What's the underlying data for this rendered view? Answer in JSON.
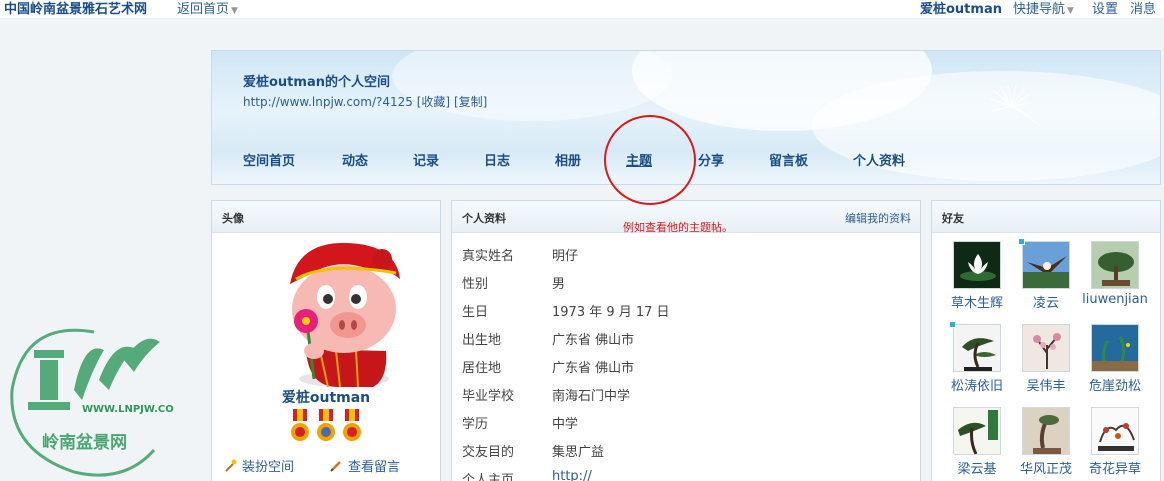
{
  "topbar": {
    "site_name": "中国岭南盆景雅石艺术网",
    "back_home": "返回首页",
    "user": "爱桩outman",
    "quick_nav": "快捷导航",
    "settings": "设置",
    "messages": "消息"
  },
  "banner": {
    "title": "爱桩outman的个人空间",
    "url": "http://www.lnpjw.com/?4125",
    "favorite": "[收藏]",
    "copy": "[复制]"
  },
  "nav": {
    "items": [
      "空间首页",
      "动态",
      "记录",
      "日志",
      "相册",
      "主题",
      "分享",
      "留言板",
      "个人资料"
    ],
    "active": "主题"
  },
  "annotation": "例如查看他的主题帖。",
  "avatar_panel": {
    "title": "头像",
    "username": "爱桩outman",
    "dress_up": "装扮空间",
    "view_messages": "查看留言"
  },
  "profile_panel": {
    "title": "个人资料",
    "edit": "编辑我的资料",
    "rows": [
      {
        "k": "真实姓名",
        "v": "明仔"
      },
      {
        "k": "性别",
        "v": "男"
      },
      {
        "k": "生日",
        "v": "1973 年 9 月 17 日"
      },
      {
        "k": "出生地",
        "v": "广东省 佛山市"
      },
      {
        "k": "居住地",
        "v": "广东省 佛山市"
      },
      {
        "k": "毕业学校",
        "v": "南海石门中学"
      },
      {
        "k": "学历",
        "v": "中学"
      },
      {
        "k": "交友目的",
        "v": "集思广益"
      },
      {
        "k": "个人主页",
        "v": "http://"
      }
    ]
  },
  "friends_panel": {
    "title": "好友",
    "friends": [
      {
        "name": "草木生辉",
        "online": false,
        "icon": "lotus"
      },
      {
        "name": "凌云",
        "online": true,
        "icon": "eagle"
      },
      {
        "name": "liuwenjian",
        "online": false,
        "icon": "bonsai"
      },
      {
        "name": "松涛依旧",
        "online": true,
        "icon": "pine"
      },
      {
        "name": "吴伟丰",
        "online": false,
        "icon": "blossom"
      },
      {
        "name": "危崖劲松",
        "online": false,
        "icon": "aquarium"
      },
      {
        "name": "梁云基",
        "online": false,
        "icon": "pine-scroll"
      },
      {
        "name": "华风正茂",
        "online": false,
        "icon": "pot"
      },
      {
        "name": "奇花异草",
        "online": false,
        "icon": "flower-pot"
      }
    ]
  },
  "watermark": {
    "text": "WWW.LNPJW.COM",
    "name": "岭南盆景网"
  },
  "colors": {
    "link": "#2b5f95",
    "title": "#1a4e86",
    "annotation": "#e0141a"
  }
}
